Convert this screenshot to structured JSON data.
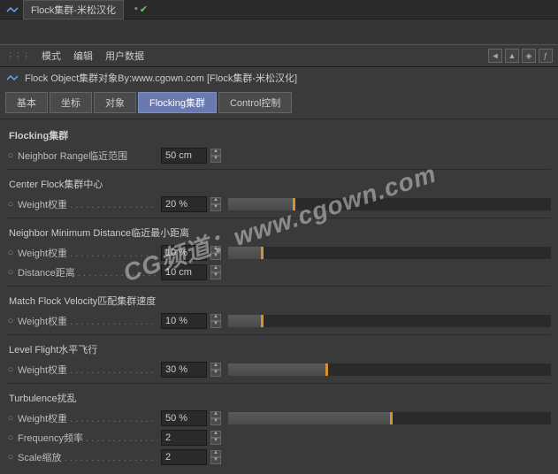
{
  "topbar": {
    "tab": "Flock集群-米松汉化"
  },
  "menubar": {
    "mode": "模式",
    "edit": "编辑",
    "userdata": "用户数据"
  },
  "title": "Flock Object集群对象By:www.cgown.com [Flock集群-米松汉化]",
  "tabs": {
    "basic": "基本",
    "coord": "坐标",
    "object": "对象",
    "flocking": "Flocking集群",
    "control": "Control控制"
  },
  "sections": {
    "flocking": "Flocking集群",
    "neighbor_range": {
      "label": "Neighbor Range临近范围",
      "value": "50 cm"
    },
    "center_flock": "Center Flock集群中心",
    "center_weight": {
      "label": "Weight权重",
      "value": "20 %",
      "pct": 20
    },
    "neighbor_min": "Neighbor Minimum Distance临近最小距离",
    "nm_weight": {
      "label": "Weight权重",
      "value": "10 %",
      "pct": 10
    },
    "nm_distance": {
      "label": "Distance距离",
      "value": "10 cm"
    },
    "match_velocity": "Match Flock Velocity匹配集群速度",
    "mv_weight": {
      "label": "Weight权重",
      "value": "10 %",
      "pct": 10
    },
    "level_flight": "Level Flight水平飞行",
    "lf_weight": {
      "label": "Weight权重",
      "value": "30 %",
      "pct": 30
    },
    "turbulence": "Turbulence扰乱",
    "tb_weight": {
      "label": "Weight权重",
      "value": "50 %",
      "pct": 50
    },
    "tb_freq": {
      "label": "Frequency频率",
      "value": "2"
    },
    "tb_scale": {
      "label": "Scale缩放",
      "value": "2"
    }
  },
  "watermark": "CG频道：www.cgown.com"
}
